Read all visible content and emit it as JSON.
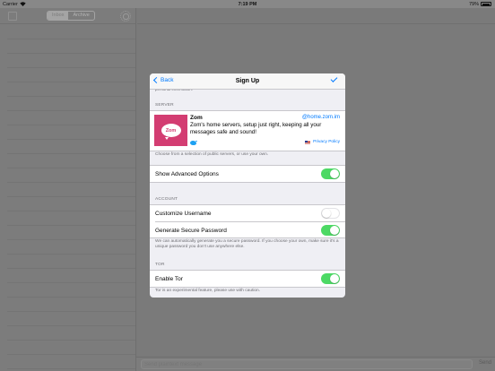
{
  "status_bar": {
    "carrier": "Carrier",
    "time": "7:19 PM",
    "battery": "79%"
  },
  "sidebar": {
    "segments": [
      "Inbox",
      "Archive"
    ]
  },
  "composer": {
    "placeholder": "Send plaintext message",
    "send_label": "Send"
  },
  "modal": {
    "nav": {
      "back_label": "Back",
      "title": "Sign Up"
    },
    "partial_text": "personal information.",
    "server_section": {
      "header": "SERVER",
      "name": "Zom",
      "domain": "@home.zom.im",
      "description": "Zom's home servers, setup just right, keeping all your messages safe and sound!",
      "logo_text": "Zom",
      "privacy_label": "Privacy Policy",
      "footer": "Choose from a selection of public servers, or use your own."
    },
    "advanced": {
      "label": "Show Advanced Options",
      "on": true
    },
    "account_section": {
      "header": "ACCOUNT",
      "rows": [
        {
          "label": "Customize Username",
          "on": false
        },
        {
          "label": "Generate Secure Password",
          "on": true
        }
      ],
      "footer": "We can automatically generate you a secure password. If you choose your own, make sure it's a unique password you don't use anywhere else."
    },
    "tor_section": {
      "header": "TOR",
      "row": {
        "label": "Enable Tor",
        "on": true
      },
      "footer": "Tor is an experimental feature, please use with caution."
    }
  },
  "colors": {
    "accent": "#007aff",
    "toggle_on": "#4cd964",
    "brand": "#d33d72"
  },
  "icons": [
    "wifi-icon",
    "battery-icon",
    "compose-icon",
    "gear-icon",
    "back-chevron-icon",
    "check-icon",
    "twitter-icon",
    "us-flag-icon"
  ]
}
